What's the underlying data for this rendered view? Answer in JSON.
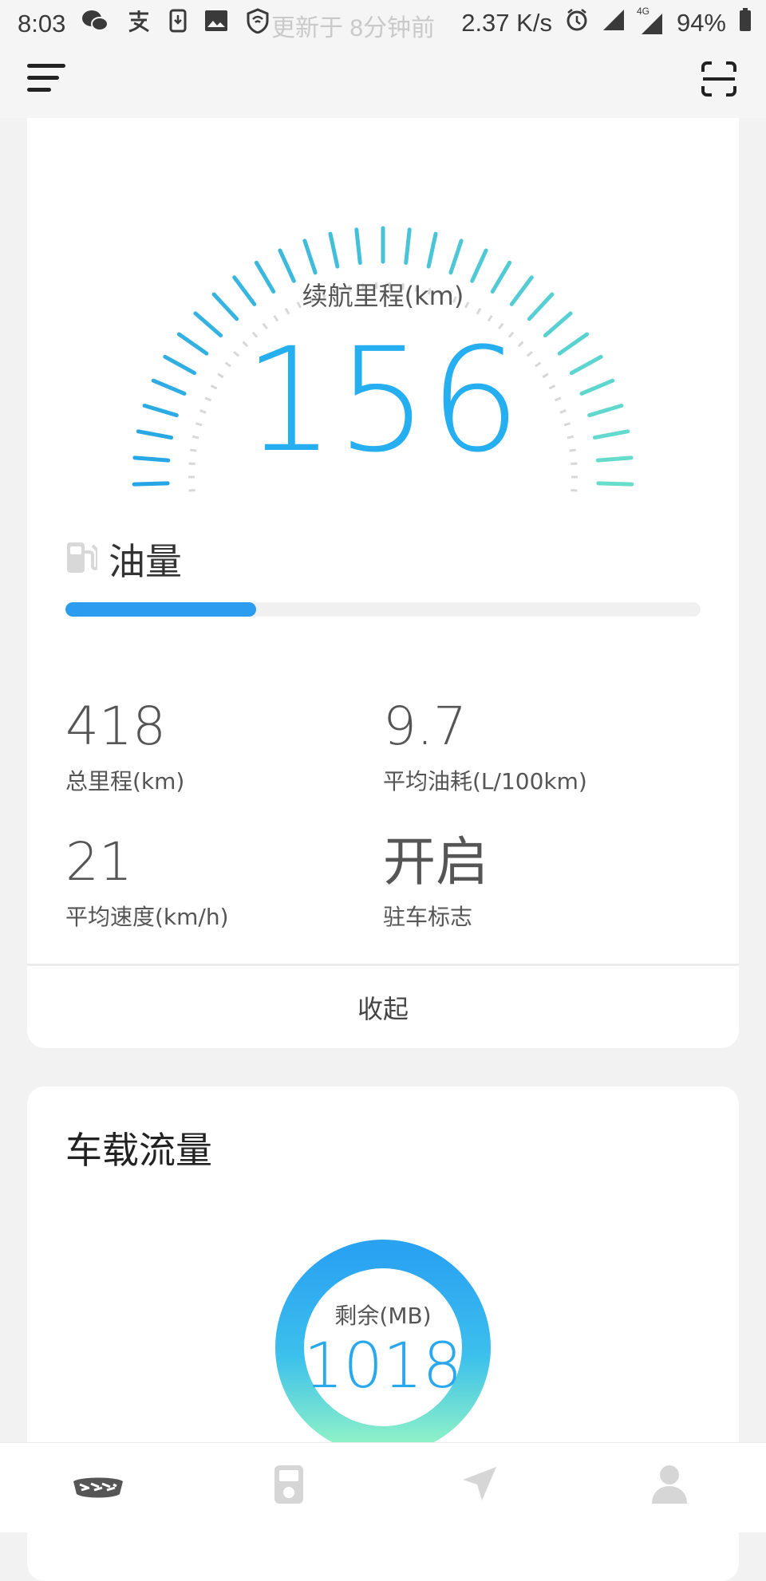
{
  "status_bar": {
    "time": "8:03",
    "ghost_text": "更新于 8分钟前",
    "net_speed": "2.37 K/s",
    "network_type": "4G",
    "battery": "94%"
  },
  "range": {
    "label": "续航里程(km)",
    "value": "156"
  },
  "fuel": {
    "title": "油量",
    "level_percent": 30
  },
  "stats": [
    {
      "value": "418",
      "label": "总里程(km)"
    },
    {
      "value": "9.7",
      "label": "平均油耗(L/100km)"
    },
    {
      "value": "21",
      "label": "平均速度(km/h)"
    },
    {
      "value": "开启",
      "label": "驻车标志"
    }
  ],
  "collapse_label": "收起",
  "data_usage": {
    "title": "车载流量",
    "label": "剩余(MB)",
    "value": "1018"
  },
  "colors": {
    "accent": "#25aef0",
    "gauge_start": "#1e9fe9",
    "gauge_end": "#6ee3c8",
    "fuel_fill": "#2b9cf0"
  }
}
